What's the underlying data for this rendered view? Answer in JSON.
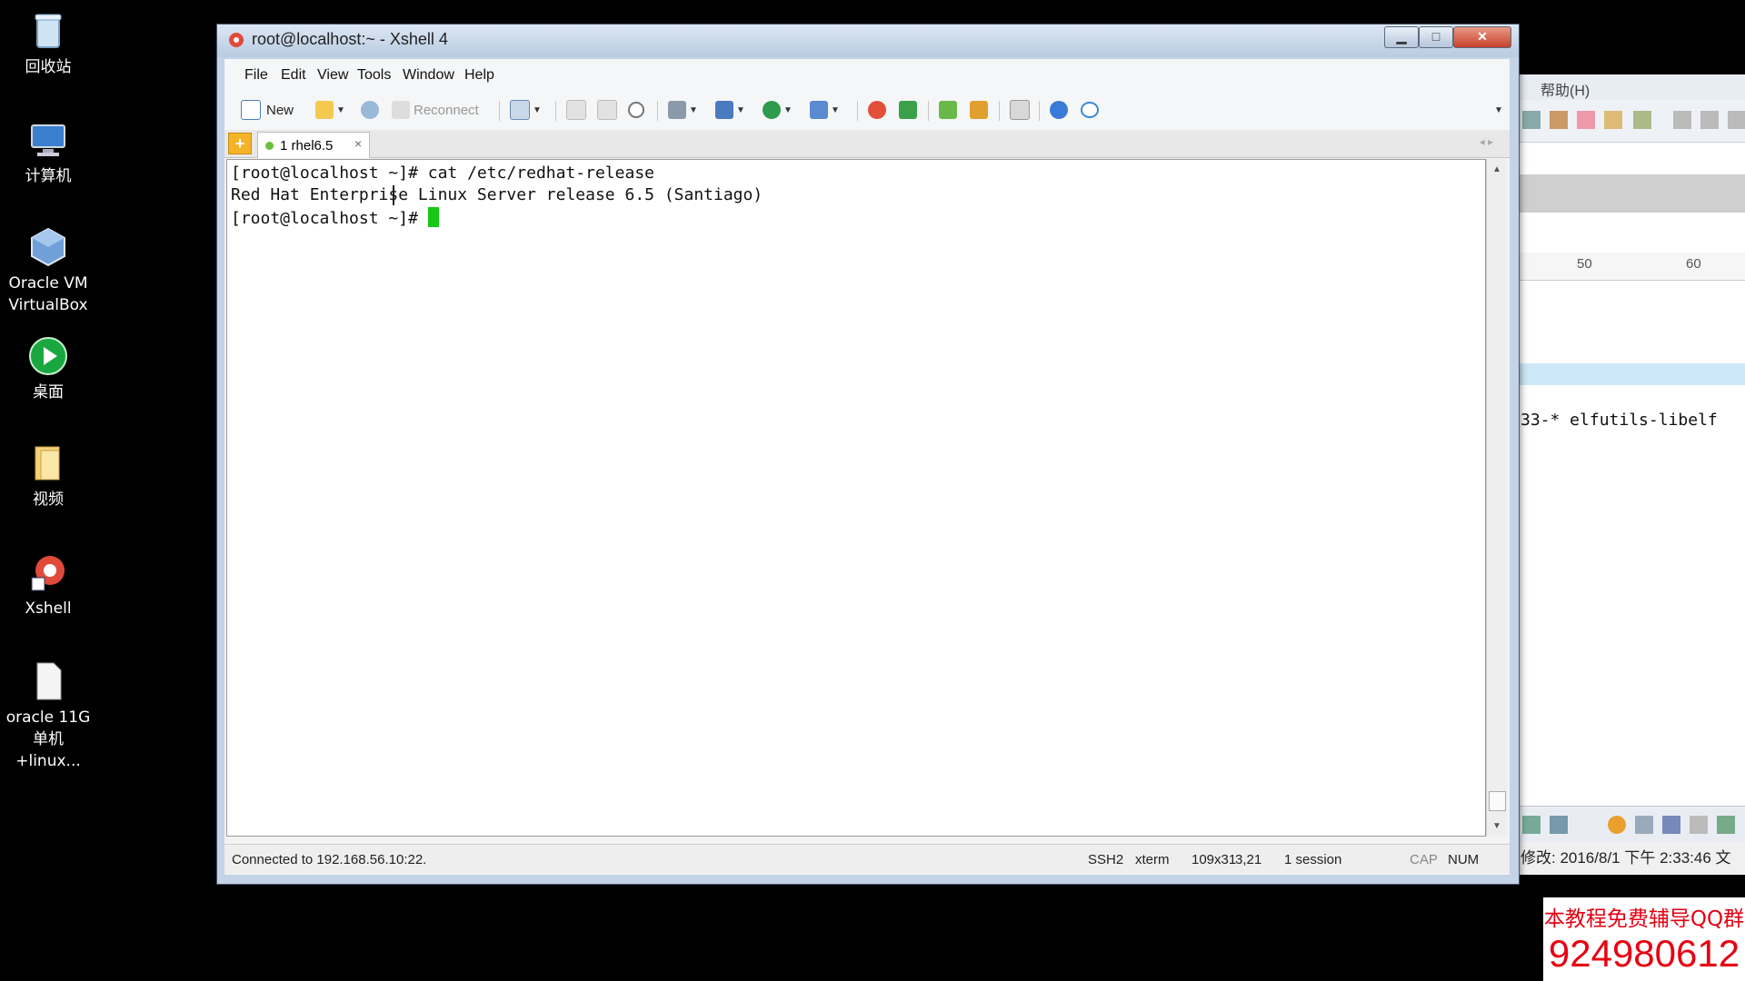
{
  "desktop": {
    "icons": [
      {
        "label": "回收站"
      },
      {
        "label": "计算机"
      },
      {
        "label": "Oracle VM VirtualBox"
      },
      {
        "label": "桌面"
      },
      {
        "label": "视频"
      },
      {
        "label": "Xshell"
      },
      {
        "label": "oracle 11G 单机+linux..."
      }
    ]
  },
  "window": {
    "title": "root@localhost:~ - Xshell 4",
    "buttons": {
      "minimize": "▁",
      "maximize": "□",
      "close": "✕"
    }
  },
  "menu": [
    "File",
    "Edit",
    "View",
    "Tools",
    "Window",
    "Help"
  ],
  "toolbar": {
    "new_label": "New",
    "reconnect_label": "Reconnect"
  },
  "tabs": [
    {
      "label": "1 rhel6.5",
      "close": "×"
    }
  ],
  "terminal": {
    "lines": [
      "[root@localhost ~]# cat /etc/redhat-release",
      "Red Hat Enterprise Linux Server release 6.5 (Santiago)",
      "[root@localhost ~]# "
    ]
  },
  "status": {
    "connection": "Connected to 192.168.56.10:22.",
    "protocol": "SSH2",
    "terminal_type": "xterm",
    "size": "109x31",
    "cursor_pos": "3,21",
    "sessions": "1 session",
    "cap": "CAP",
    "num": "NUM"
  },
  "background_window": {
    "menu_item": "帮助(H)",
    "ruler_50": "50",
    "ruler_60": "60",
    "code_fragment": "33-* elfutils-libelf",
    "modified": "修改: 2016/8/1 下午 2:33:46 文"
  },
  "watermark": {
    "line1": "本教程免费辅导QQ群",
    "line2": "924980612"
  },
  "colors": {
    "cursor": "#14c814",
    "close_button": "#c6422a",
    "watermark": "#e60012"
  }
}
